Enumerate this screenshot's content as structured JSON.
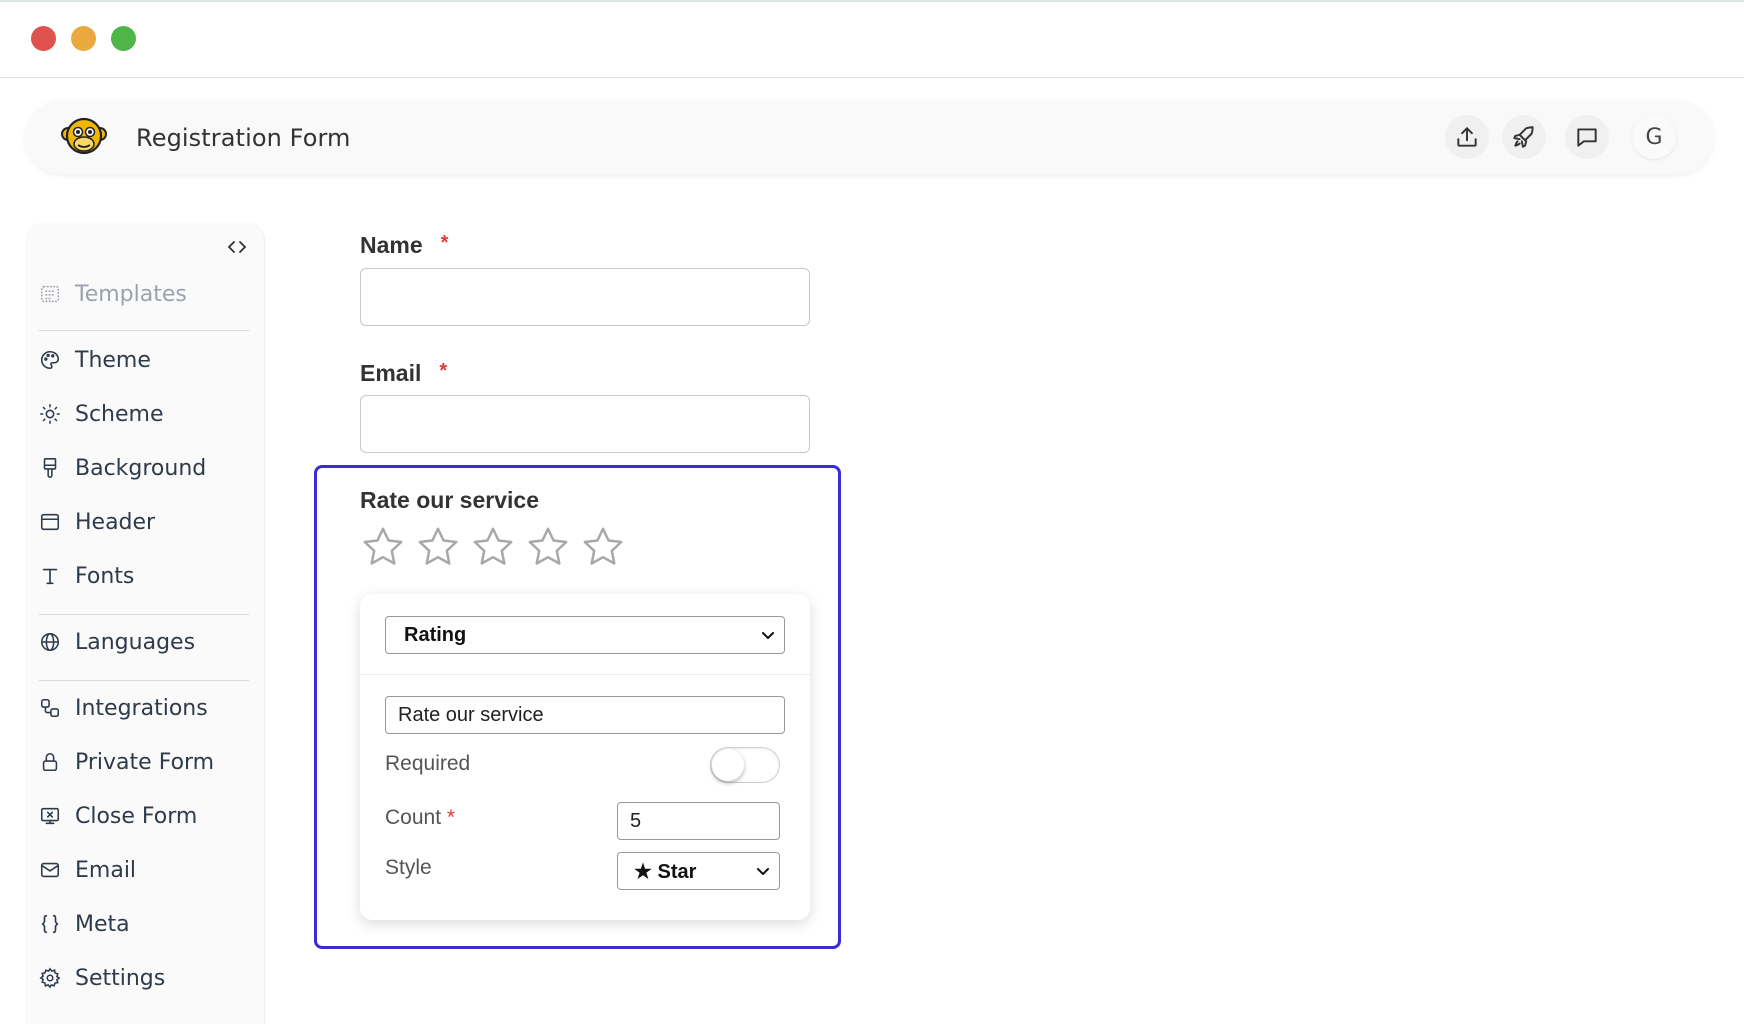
{
  "window": {
    "controls": [
      "close",
      "minimize",
      "maximize"
    ]
  },
  "header": {
    "title": "Registration Form",
    "user_initial": "G",
    "icons": [
      "upload-icon",
      "rocket-icon",
      "chat-icon"
    ]
  },
  "sidebar": {
    "items": [
      {
        "label": "Templates",
        "icon": "templates-icon"
      },
      {
        "label": "Theme",
        "icon": "palette-icon"
      },
      {
        "label": "Scheme",
        "icon": "sun-icon"
      },
      {
        "label": "Background",
        "icon": "paint-brush-icon"
      },
      {
        "label": "Header",
        "icon": "header-icon"
      },
      {
        "label": "Fonts",
        "icon": "text-icon"
      },
      {
        "label": "Languages",
        "icon": "globe-icon"
      },
      {
        "label": "Integrations",
        "icon": "integrations-icon"
      },
      {
        "label": "Private Form",
        "icon": "lock-icon"
      },
      {
        "label": "Close Form",
        "icon": "close-form-icon"
      },
      {
        "label": "Email",
        "icon": "mail-icon"
      },
      {
        "label": "Meta",
        "icon": "braces-icon"
      },
      {
        "label": "Settings",
        "icon": "gear-icon"
      }
    ]
  },
  "form": {
    "name": {
      "label": "Name",
      "required_mark": "*",
      "value": ""
    },
    "email": {
      "label": "Email",
      "required_mark": "*",
      "value": ""
    },
    "rating": {
      "title": "Rate our service",
      "star_count": 5,
      "selected": 0
    }
  },
  "editor": {
    "type_select": "Rating",
    "question_text": "Rate our service",
    "required_label": "Required",
    "required_on": false,
    "count_label": "Count",
    "count_required_mark": "*",
    "count_value": "5",
    "style_label": "Style",
    "style_value": "★ Star"
  },
  "colors": {
    "accent_border": "#3a2bd6",
    "required": "#e53935",
    "star_outline": "#a8a8a8"
  }
}
